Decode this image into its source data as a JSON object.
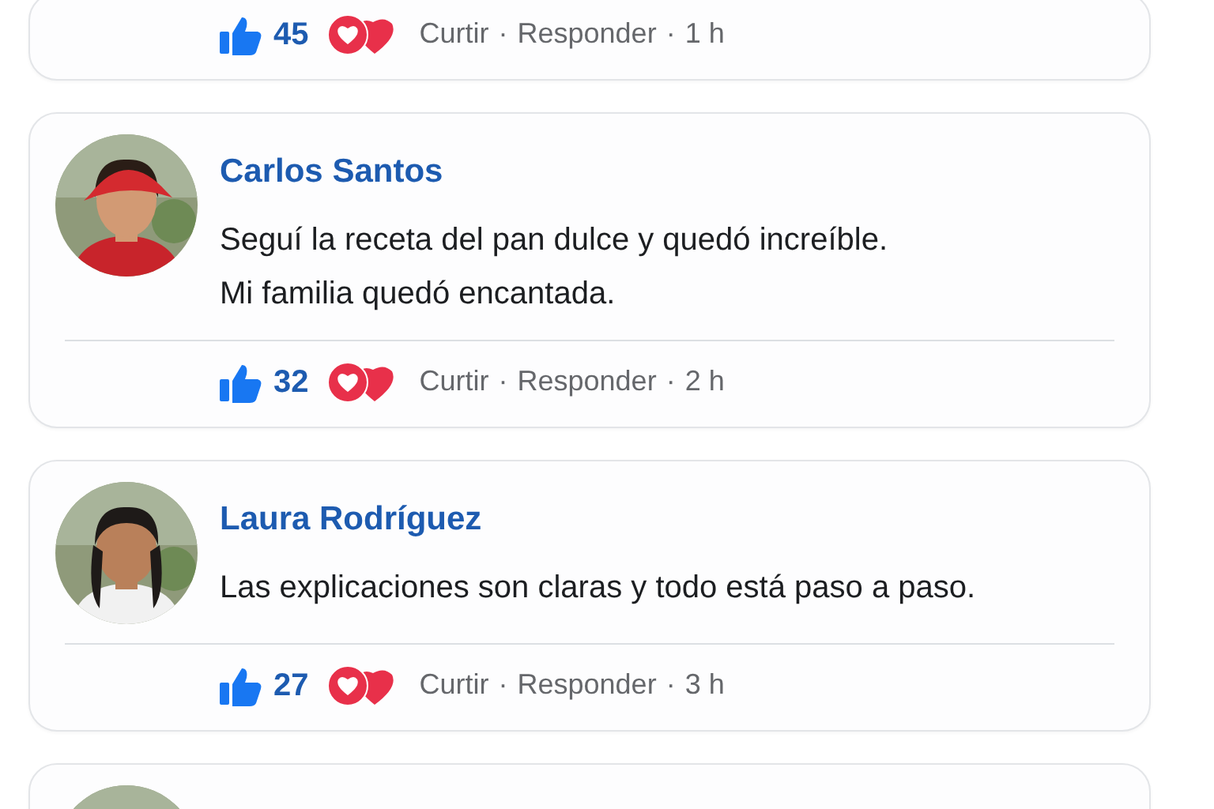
{
  "comments": [
    {
      "likes": "45",
      "actions": {
        "links": [
          "Curtir",
          "Responder"
        ],
        "separators": [
          "·",
          "·"
        ],
        "time": "1 h"
      }
    },
    {
      "avatar": {
        "kind": "picture"
      },
      "name": "Carlos Santos",
      "text": "Seguí la receta del pan dulce y quedó increíble.\nMi familia quedó encantada.",
      "likes": "32",
      "actions": {
        "links": [
          "Curtir",
          "Responder"
        ],
        "separators": [
          "·",
          "·"
        ],
        "time": "2 h"
      }
    },
    {
      "avatar": {
        "kind": "picture"
      },
      "name": "Laura Rodríguez",
      "text": "Las explicaciones son claras y todo está paso a paso.",
      "likes": "27",
      "actions": {
        "links": [
          "Curtir",
          "Responder"
        ],
        "separators": [
          "·",
          "·"
        ],
        "time": "3 h"
      }
    },
    {
      "avatar": {
        "kind": "picture"
      }
    }
  ]
}
